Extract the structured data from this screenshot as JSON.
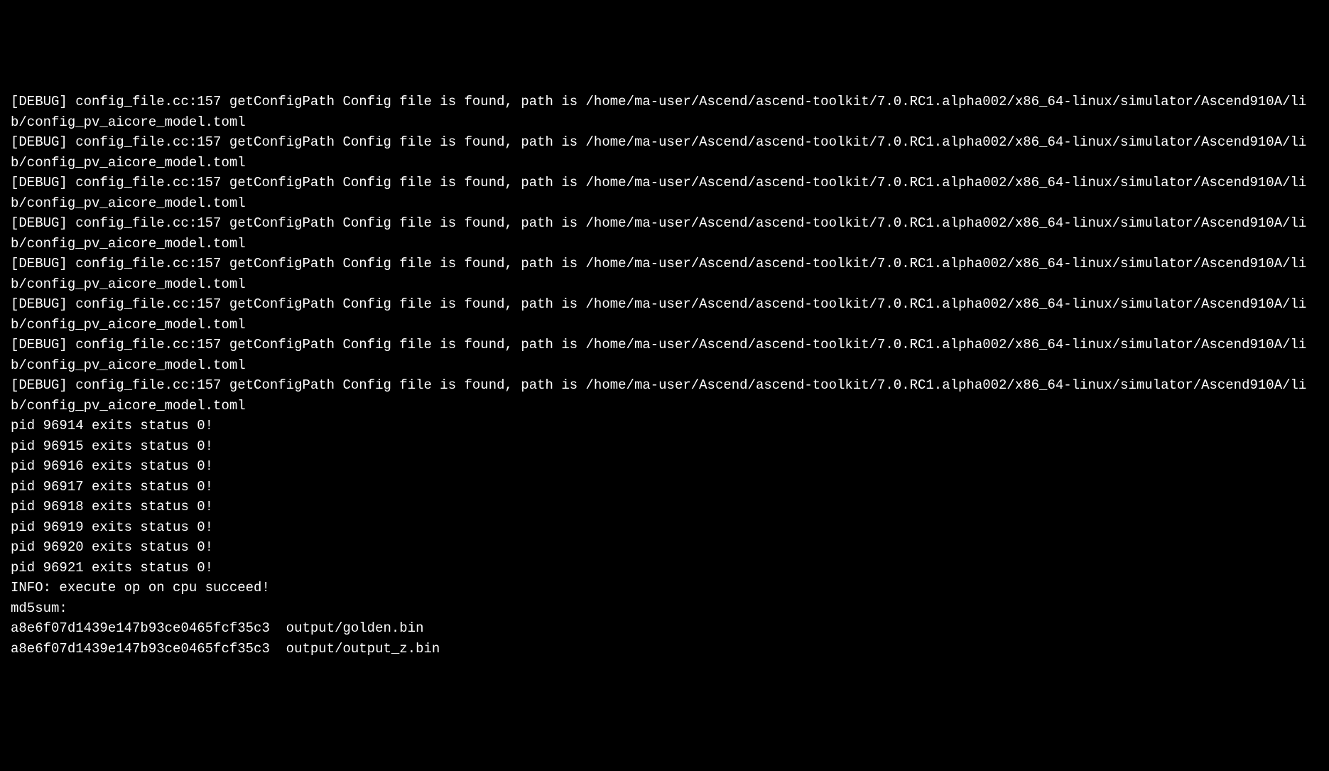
{
  "terminal": {
    "debug_lines": [
      "[DEBUG] config_file.cc:157 getConfigPath Config file is found, path is /home/ma-user/Ascend/ascend-toolkit/7.0.RC1.alpha002/x86_64-linux/simulator/Ascend910A/lib/config_pv_aicore_model.toml",
      "[DEBUG] config_file.cc:157 getConfigPath Config file is found, path is /home/ma-user/Ascend/ascend-toolkit/7.0.RC1.alpha002/x86_64-linux/simulator/Ascend910A/lib/config_pv_aicore_model.toml",
      "[DEBUG] config_file.cc:157 getConfigPath Config file is found, path is /home/ma-user/Ascend/ascend-toolkit/7.0.RC1.alpha002/x86_64-linux/simulator/Ascend910A/lib/config_pv_aicore_model.toml",
      "[DEBUG] config_file.cc:157 getConfigPath Config file is found, path is /home/ma-user/Ascend/ascend-toolkit/7.0.RC1.alpha002/x86_64-linux/simulator/Ascend910A/lib/config_pv_aicore_model.toml",
      "[DEBUG] config_file.cc:157 getConfigPath Config file is found, path is /home/ma-user/Ascend/ascend-toolkit/7.0.RC1.alpha002/x86_64-linux/simulator/Ascend910A/lib/config_pv_aicore_model.toml",
      "[DEBUG] config_file.cc:157 getConfigPath Config file is found, path is /home/ma-user/Ascend/ascend-toolkit/7.0.RC1.alpha002/x86_64-linux/simulator/Ascend910A/lib/config_pv_aicore_model.toml",
      "[DEBUG] config_file.cc:157 getConfigPath Config file is found, path is /home/ma-user/Ascend/ascend-toolkit/7.0.RC1.alpha002/x86_64-linux/simulator/Ascend910A/lib/config_pv_aicore_model.toml",
      "[DEBUG] config_file.cc:157 getConfigPath Config file is found, path is /home/ma-user/Ascend/ascend-toolkit/7.0.RC1.alpha002/x86_64-linux/simulator/Ascend910A/lib/config_pv_aicore_model.toml"
    ],
    "pid_lines": [
      "pid 96914 exits status 0!",
      "pid 96915 exits status 0!",
      "pid 96916 exits status 0!",
      "pid 96917 exits status 0!",
      "pid 96918 exits status 0!",
      "pid 96919 exits status 0!",
      "pid 96920 exits status 0!",
      "pid 96921 exits status 0!"
    ],
    "info_line": "INFO: execute op on cpu succeed!",
    "md5sum_label": "md5sum:",
    "md5_lines": [
      "a8e6f07d1439e147b93ce0465fcf35c3  output/golden.bin",
      "a8e6f07d1439e147b93ce0465fcf35c3  output/output_z.bin"
    ]
  }
}
